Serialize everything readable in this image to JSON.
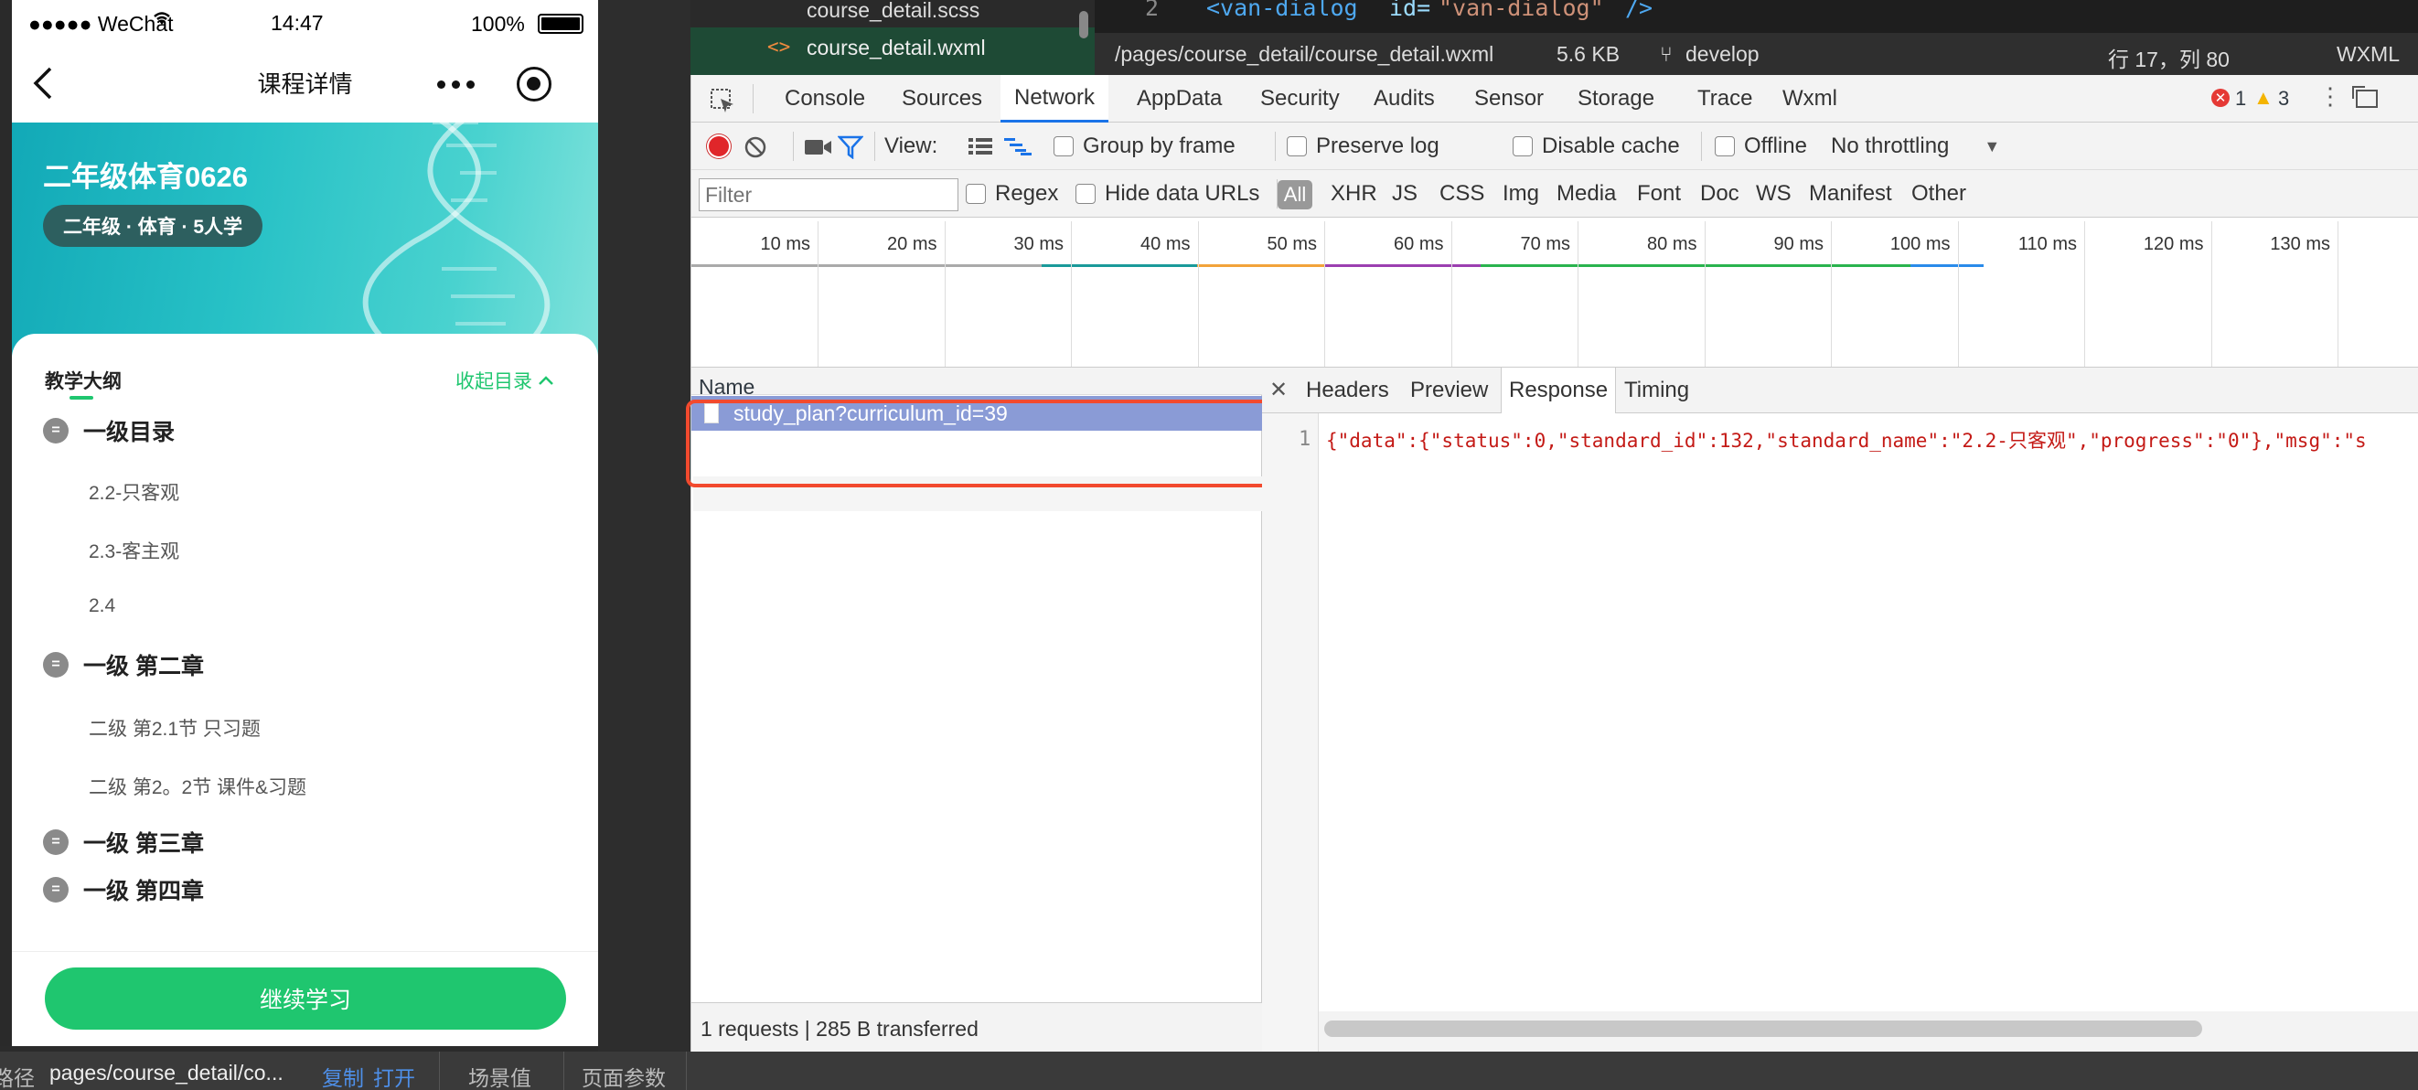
{
  "phone": {
    "status": {
      "carrier": "●●●●● WeChat",
      "time": "14:47",
      "battery": "100%"
    },
    "nav": {
      "title": "课程详情"
    },
    "banner": {
      "title": "二年级体育0626",
      "tag": "二年级 · 体育 · 5人学"
    },
    "syllabus": {
      "heading": "教学大纲",
      "collapse": "收起目录",
      "sections": [
        {
          "title": "一级目录",
          "items": [
            "2.2-只客观",
            "2.3-客主观",
            "2.4"
          ]
        },
        {
          "title": "一级 第二章",
          "items": [
            "二级 第2.1节 只习题",
            "二级 第2。2节 课件&习题"
          ]
        },
        {
          "title": "一级 第三章",
          "items": []
        },
        {
          "title": "一级 第四章",
          "items": []
        }
      ]
    },
    "continue_button": "继续学习"
  },
  "editor": {
    "files": [
      {
        "name": "course_detail.scss",
        "prefix": ""
      },
      {
        "name": "course_detail.wxml",
        "prefix": "<>"
      }
    ],
    "code_line_num": "2",
    "code_tag": "<van-dialog",
    "code_attr": "id=",
    "code_value": "\"van-dialog\"",
    "code_close": "/>",
    "path": "/pages/course_detail/course_detail.wxml",
    "size": "5.6 KB",
    "branch": "develop",
    "position": "行 17，列 80",
    "lang": "WXML"
  },
  "devtools": {
    "tabs": [
      "Console",
      "Sources",
      "Network",
      "AppData",
      "Security",
      "Audits",
      "Sensor",
      "Storage",
      "Trace",
      "Wxml"
    ],
    "active_tab": "Network",
    "errors": "1",
    "warnings": "3",
    "toolbar": {
      "view": "View:",
      "group_by_frame": "Group by frame",
      "preserve_log": "Preserve log",
      "disable_cache": "Disable cache",
      "offline": "Offline",
      "throttling": "No throttling"
    },
    "filter": {
      "placeholder": "Filter",
      "regex": "Regex",
      "hide_data_urls": "Hide data URLs",
      "types": [
        "All",
        "XHR",
        "JS",
        "CSS",
        "Img",
        "Media",
        "Font",
        "Doc",
        "WS",
        "Manifest",
        "Other"
      ]
    },
    "timeline_ticks": [
      "10 ms",
      "20 ms",
      "30 ms",
      "40 ms",
      "50 ms",
      "60 ms",
      "70 ms",
      "80 ms",
      "90 ms",
      "100 ms",
      "110 ms",
      "120 ms",
      "130 ms"
    ],
    "requests_header": "Name",
    "request": "study_plan?curriculum_id=39",
    "detail_tabs": [
      "Headers",
      "Preview",
      "Response",
      "Timing"
    ],
    "active_detail_tab": "Response",
    "response_line": "1",
    "response_text": "{\"data\":{\"status\":0,\"standard_id\":132,\"standard_name\":\"2.2-只客观\",\"progress\":\"0\"},\"msg\":\"s",
    "summary": "1 requests | 285 B transferred",
    "colors": {
      "highlight": "#f24a2e",
      "selected_row": "#8a9bd6",
      "active_tab_line": "#1a73e8",
      "green": "#1fc66f"
    }
  },
  "bottom_bar": {
    "path_label": "路径",
    "path": "pages/course_detail/co...",
    "copy": "复制",
    "open": "打开",
    "scene": "场景值",
    "params": "页面参数"
  }
}
